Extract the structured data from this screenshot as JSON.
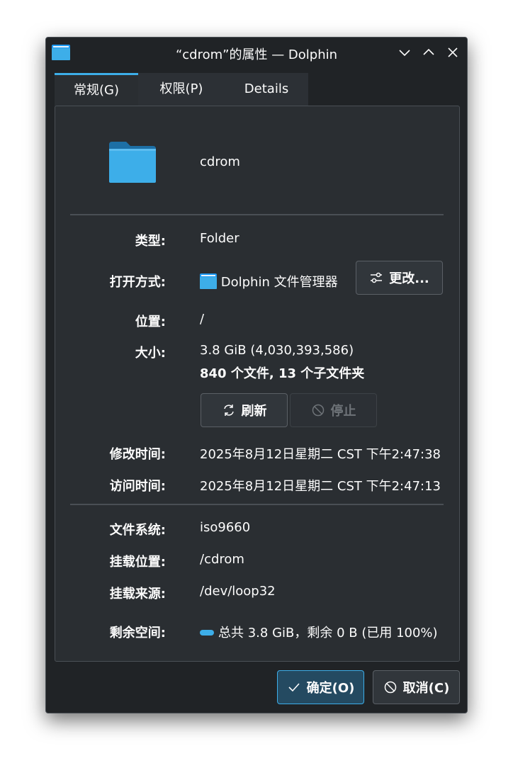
{
  "window": {
    "title": "“cdrom”的属性 — Dolphin",
    "icon": "folder-icon"
  },
  "tabs": [
    {
      "label": "常规(G)"
    },
    {
      "label": "权限(P)"
    },
    {
      "label": "Details"
    }
  ],
  "general": {
    "name": "cdrom",
    "type_label": "类型:",
    "type_value": "Folder",
    "open_with_label": "打开方式:",
    "open_with_value": "Dolphin 文件管理器",
    "change_button": "更改...",
    "location_label": "位置:",
    "location_value": "/",
    "size_label": "大小:",
    "size_value": "3.8 GiB (4,030,393,586)",
    "size_detail": "840 个文件, 13 个子文件夹",
    "refresh_button": "刷新",
    "stop_button": "停止",
    "modified_label": "修改时间:",
    "modified_value": "2025年8月12日星期二 CST 下午2:47:38",
    "accessed_label": "访问时间:",
    "accessed_value": "2025年8月12日星期二 CST 下午2:47:13",
    "filesystem_label": "文件系统:",
    "filesystem_value": "iso9660",
    "mountpoint_label": "挂载位置:",
    "mountpoint_value": "/cdrom",
    "mountsource_label": "挂载来源:",
    "mountsource_value": "/dev/loop32",
    "freespace_label": "剩余空间:",
    "freespace_value": "总共 3.8 GiB，剩余 0 B (已用 100%)",
    "usage_percent": 100
  },
  "footer": {
    "ok_button": "确定(O)",
    "cancel_button": "取消(C)"
  },
  "colors": {
    "accent": "#3daee9",
    "background": "#202326"
  }
}
